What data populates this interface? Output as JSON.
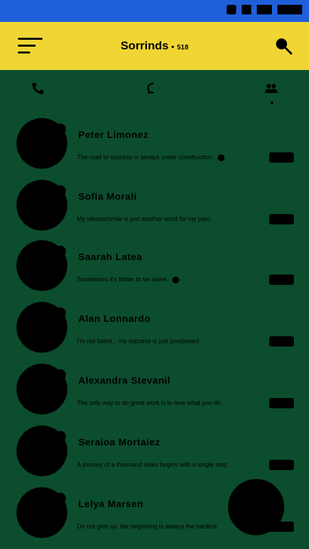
{
  "colors": {
    "status_bar": "#1f5fd9",
    "app_bar": "#f0d634",
    "background": "#0c4d2e",
    "foreground": "#000000"
  },
  "app_bar": {
    "title": "Sorrinds",
    "separator": "•",
    "count": "518",
    "menu_icon": "hamburger-menu-icon",
    "search_icon": "search-icon"
  },
  "tabs": [
    {
      "icon": "phone-icon"
    },
    {
      "icon": "chat-icon"
    },
    {
      "icon": "group-icon",
      "active": true
    }
  ],
  "chats": [
    {
      "name": "Peter Limonez",
      "message": "The road to success is always under construction.",
      "seen": true
    },
    {
      "name": "Sofia Morali",
      "message": "My silence/smile is just another word for my pain.",
      "seen": false
    },
    {
      "name": "Saarah Latea",
      "message": "Sometimes it's better to be alone.",
      "seen": true
    },
    {
      "name": "Alan Lonnardo",
      "message": "I'm not failed... my success is just postponed.",
      "seen": false
    },
    {
      "name": "Alexandra Stevanil",
      "message": "The only way to do great work is to love what you do.",
      "seen": false
    },
    {
      "name": "Seraioa Mortaiez",
      "message": "A journey of a thousand miles begins with a single step.",
      "seen": false
    },
    {
      "name": "Lelya Marsen",
      "message": "Do not give up, the beginning is always the hardest",
      "seen": false
    }
  ],
  "fab": {
    "icon": "new-chat-icon"
  }
}
